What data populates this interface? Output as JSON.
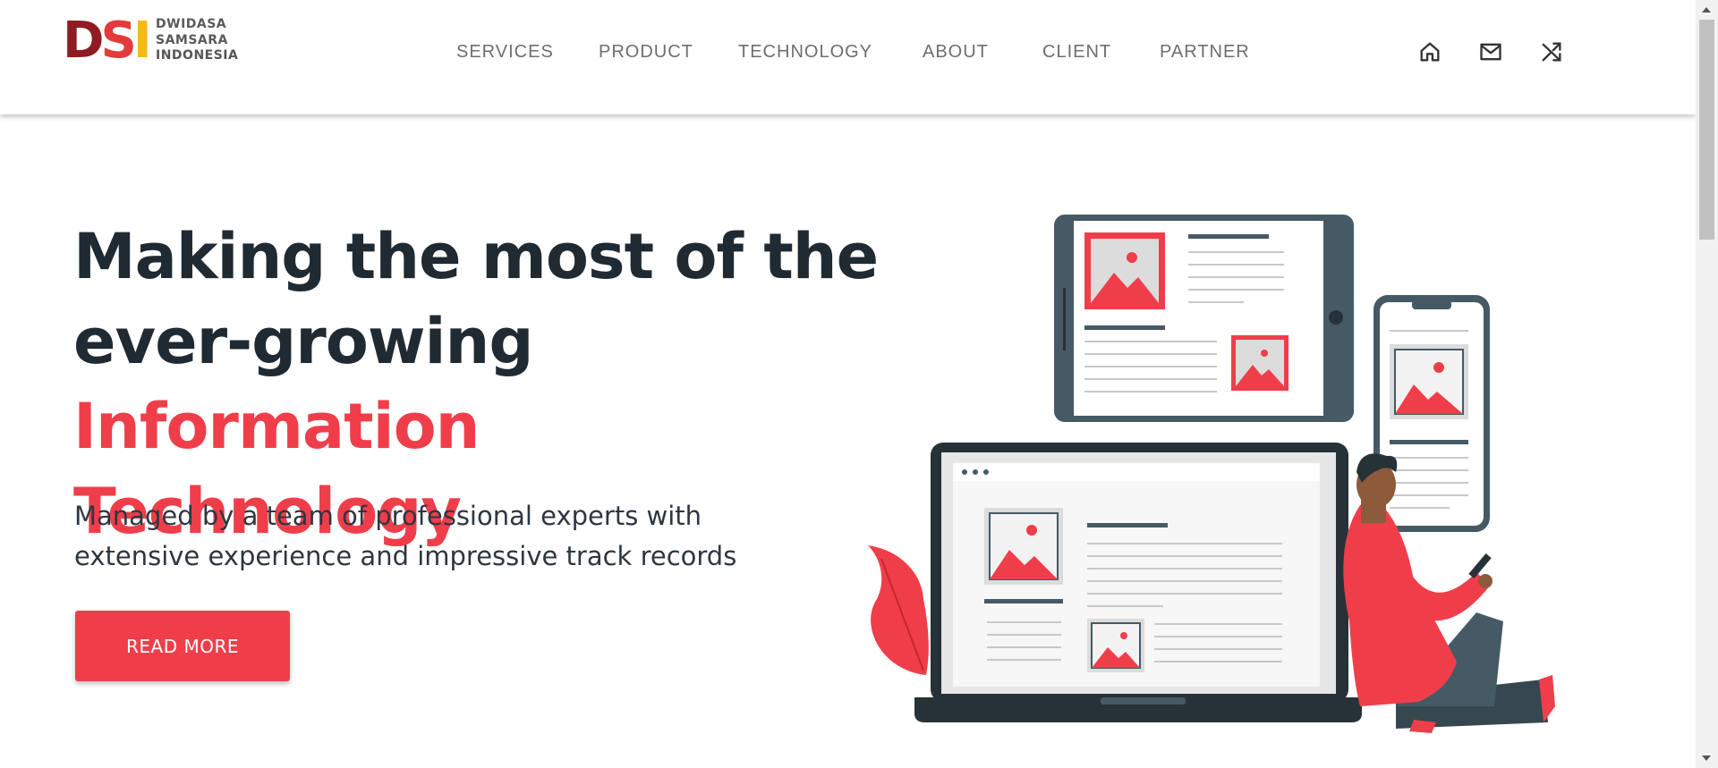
{
  "brand": {
    "logo_letters": [
      "D",
      "S",
      "I"
    ],
    "logo_lines": [
      "DWIDASA",
      "SAMSARA",
      "INDONESIA"
    ],
    "colors": {
      "dark_red": "#8e1c22",
      "red": "#e33b3b",
      "yellow": "#f5b91a"
    }
  },
  "nav": {
    "items": [
      "SERVICES",
      "PRODUCT",
      "TECHNOLOGY",
      "ABOUT",
      "CLIENT",
      "PARTNER"
    ]
  },
  "header_icons": [
    "home-icon",
    "mail-icon",
    "shuffle-icon"
  ],
  "hero": {
    "title_line1": "Making the most of the",
    "title_line2": "ever-growing",
    "title_accent": "Information Technology",
    "subtitle_line1": "Managed by a team of professional experts with",
    "subtitle_line2": "extensive experience and impressive track records",
    "cta_label": "READ MORE"
  },
  "colors": {
    "accent": "#ef3e4a",
    "heading": "#1f2a33",
    "device_frame": "#455a64"
  }
}
